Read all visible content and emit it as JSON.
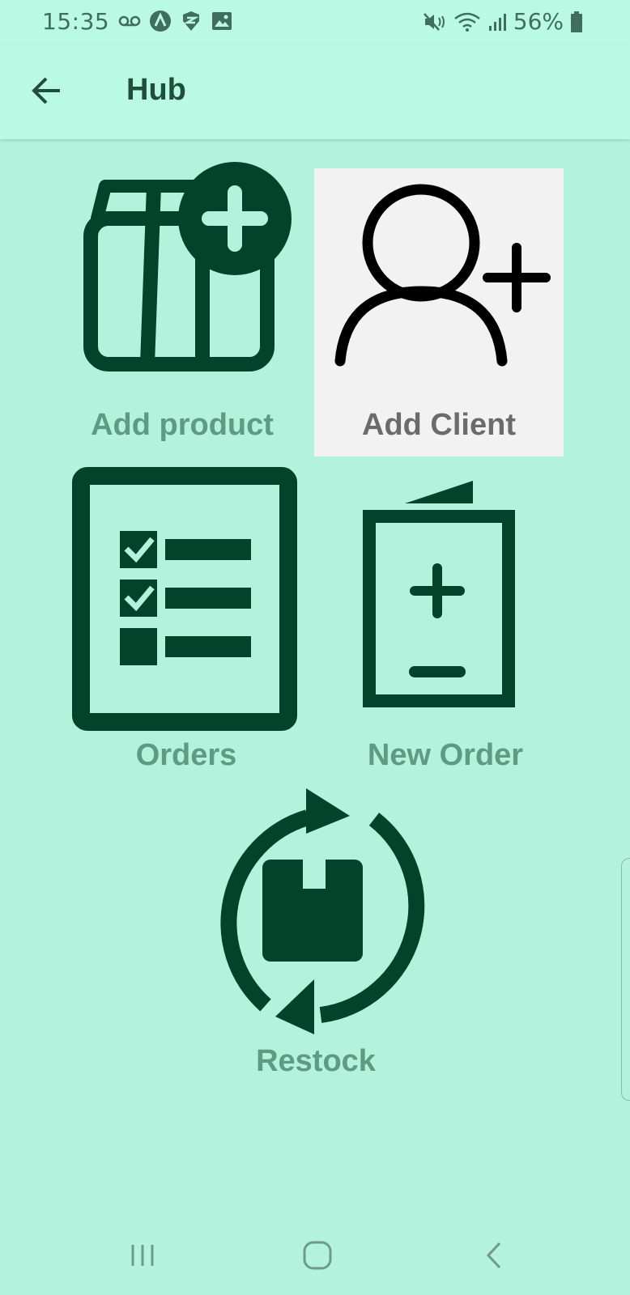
{
  "status_bar": {
    "time": "15:35",
    "battery": "56%"
  },
  "app_bar": {
    "title": "Hub"
  },
  "tiles": [
    {
      "label": "Add product",
      "icon": "box-plus-icon"
    },
    {
      "label": "Add Client",
      "icon": "user-plus-icon"
    },
    {
      "label": "Orders",
      "icon": "checklist-icon"
    },
    {
      "label": "New Order",
      "icon": "order-form-icon"
    },
    {
      "label": "Restock",
      "icon": "restock-icon"
    }
  ],
  "colors": {
    "background": "#b3f2dc",
    "app_bar": "#baf9e3",
    "icon_dark_green": "#03432b",
    "label_green": "#5f9a82",
    "highlight_tile": "#f2f2f2"
  }
}
